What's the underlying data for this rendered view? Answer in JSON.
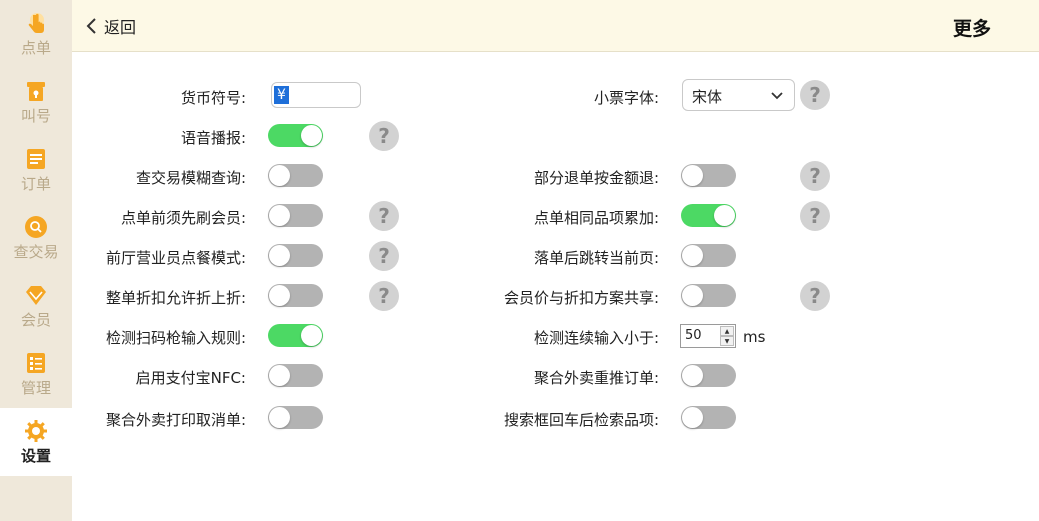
{
  "sidebar": {
    "items": [
      {
        "label": "点单",
        "icon": "hand-pointer-icon",
        "active": false
      },
      {
        "label": "叫号",
        "icon": "ticket-icon",
        "active": false
      },
      {
        "label": "订单",
        "icon": "order-list-icon",
        "active": false
      },
      {
        "label": "查交易",
        "icon": "search-circle-icon",
        "active": false
      },
      {
        "label": "会员",
        "icon": "diamond-icon",
        "active": false
      },
      {
        "label": "管理",
        "icon": "checklist-icon",
        "active": false
      },
      {
        "label": "设置",
        "icon": "gear-icon",
        "active": true
      }
    ]
  },
  "header": {
    "back_label": "返回",
    "title": "更多"
  },
  "colors": {
    "accent": "#f5a623",
    "toggle_on": "#4cd964",
    "toggle_off": "#b3b3b3",
    "header_bg": "#fdf9e6",
    "sidebar_bg": "#efe8da"
  },
  "settings": {
    "currency": {
      "label": "货币符号:",
      "value": "¥"
    },
    "receipt_font": {
      "label": "小票字体:",
      "value": "宋体"
    },
    "voice": {
      "label": "语音播报:",
      "on": true
    },
    "fuzzy_query": {
      "label": "查交易模糊查询:",
      "on": false
    },
    "partial_refund": {
      "label": "部分退单按金额退:",
      "on": false
    },
    "swipe_member": {
      "label": "点单前须先刷会员:",
      "on": false
    },
    "same_item_add": {
      "label": "点单相同品项累加:",
      "on": true
    },
    "waiter_mode": {
      "label": "前厅营业员点餐模式:",
      "on": false
    },
    "jump_page": {
      "label": "落单后跳转当前页:",
      "on": false
    },
    "discount_on_discount": {
      "label": "整单折扣允许折上折:",
      "on": false
    },
    "member_price_share": {
      "label": "会员价与折扣方案共享:",
      "on": false
    },
    "scanner_rule": {
      "label": "检测扫码枪输入规则:",
      "on": true
    },
    "continuous_input": {
      "label": "检测连续输入小于:",
      "value": "50",
      "unit": "ms"
    },
    "alipay_nfc": {
      "label": "启用支付宝NFC:",
      "on": false
    },
    "takeaway_push": {
      "label": "聚合外卖重推订单:",
      "on": false
    },
    "takeaway_print_cancel": {
      "label": "聚合外卖打印取消单:",
      "on": false
    },
    "search_enter": {
      "label": "搜索框回车后检索品项:",
      "on": false
    }
  }
}
